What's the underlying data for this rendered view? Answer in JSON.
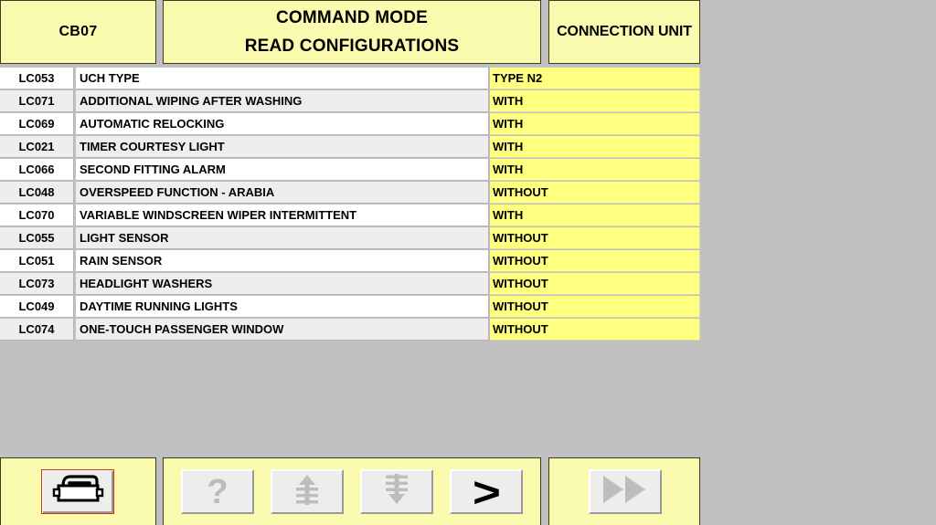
{
  "window": {
    "background_color": "#c0c0c0",
    "panel_color": "#fbfbb0",
    "value_color": "#ffff80",
    "accent_color": "#d03018"
  },
  "header": {
    "unit_code": "CB07",
    "mode_title_line1": "COMMAND MODE",
    "mode_title_line2": "READ CONFIGURATIONS",
    "connection_label": "CONNECTION UNIT"
  },
  "table": {
    "columns": [
      "code",
      "description",
      "value"
    ],
    "rows": [
      {
        "code": "LC053",
        "description": "UCH TYPE",
        "value": "TYPE N2"
      },
      {
        "code": "LC071",
        "description": "ADDITIONAL WIPING AFTER WASHING",
        "value": "WITH"
      },
      {
        "code": "LC069",
        "description": "AUTOMATIC RELOCKING",
        "value": "WITH"
      },
      {
        "code": "LC021",
        "description": "TIMER COURTESY LIGHT",
        "value": "WITH"
      },
      {
        "code": "LC066",
        "description": "SECOND FITTING ALARM",
        "value": "WITH"
      },
      {
        "code": "LC048",
        "description": "OVERSPEED FUNCTION - ARABIA",
        "value": "WITHOUT"
      },
      {
        "code": "LC070",
        "description": "VARIABLE WINDSCREEN WIPER INTERMITTENT",
        "value": "WITH"
      },
      {
        "code": "LC055",
        "description": "LIGHT SENSOR",
        "value": "WITHOUT"
      },
      {
        "code": "LC051",
        "description": "RAIN SENSOR",
        "value": "WITHOUT"
      },
      {
        "code": "LC073",
        "description": "HEADLIGHT WASHERS",
        "value": "WITHOUT"
      },
      {
        "code": "LC049",
        "description": "DAYTIME RUNNING LIGHTS",
        "value": "WITHOUT"
      },
      {
        "code": "LC074",
        "description": "ONE-TOUCH PASSENGER WINDOW",
        "value": "WITHOUT"
      }
    ]
  },
  "toolbar": {
    "print_icon": "printer-icon",
    "help_icon": "question-mark-icon",
    "scroll_top_icon": "scroll-to-top-icon",
    "scroll_bottom_icon": "scroll-to-bottom-icon",
    "next_label": ">",
    "fast_forward_icon": "fast-forward-icon"
  }
}
